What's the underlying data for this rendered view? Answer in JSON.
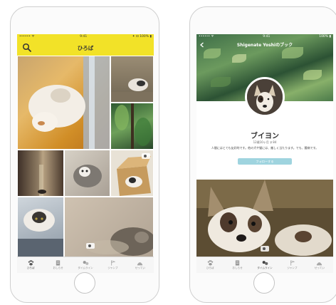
{
  "left_phone": {
    "status": {
      "carrier": "•••••• ᯤ",
      "time": "9:41",
      "battery": "✦ ⊡ 100% ▮"
    },
    "header": {
      "title": "ひろば",
      "search_icon": "search-icon"
    },
    "grid_photos": [
      {
        "subject": "orange-cat",
        "has_video": false
      },
      {
        "subject": "cat-on-floor",
        "has_video": false
      },
      {
        "subject": "plants",
        "has_video": false
      },
      {
        "subject": "alley",
        "has_video": false
      },
      {
        "subject": "grey-kitten",
        "has_video": false
      },
      {
        "subject": "cat-in-box",
        "has_video": true
      },
      {
        "subject": "tabby-cat",
        "has_video": false
      },
      {
        "subject": "dog-lying",
        "has_video": true
      }
    ],
    "tabs": [
      {
        "label": "ひろば",
        "icon": "paw-icon",
        "active": true
      },
      {
        "label": "おしらせ",
        "icon": "notice-icon",
        "active": false
      },
      {
        "label": "タイムライン",
        "icon": "paws-icon",
        "active": false
      },
      {
        "label": "ジャンプ",
        "icon": "flag-icon",
        "active": false
      },
      {
        "label": "せってい",
        "icon": "book-icon",
        "active": false
      }
    ]
  },
  "right_phone": {
    "status": {
      "carrier": "•••••• ᯤ",
      "time": "9:41",
      "battery": "100% ▮"
    },
    "nav": {
      "title": "Shigenate Yoshiのブック"
    },
    "profile": {
      "name": "ブイヨン",
      "meta": "12歳10ヶ月  ♀ 84",
      "bio": "人間にはとても友好的です。他の犬や猫には、厳しく当たります。でも、臆病です。",
      "follow_label": "フォローする"
    },
    "tabs": [
      {
        "label": "ひろば",
        "icon": "paw-icon",
        "active": false
      },
      {
        "label": "おしらせ",
        "icon": "notice-icon",
        "active": false
      },
      {
        "label": "タイムライン",
        "icon": "paws-icon",
        "active": true
      },
      {
        "label": "ジャンプ",
        "icon": "flag-icon",
        "active": false
      },
      {
        "label": "せってい",
        "icon": "book-icon",
        "active": false
      }
    ]
  },
  "colors": {
    "header_yellow": "#f2e228",
    "follow_button": "#9fd4df"
  }
}
